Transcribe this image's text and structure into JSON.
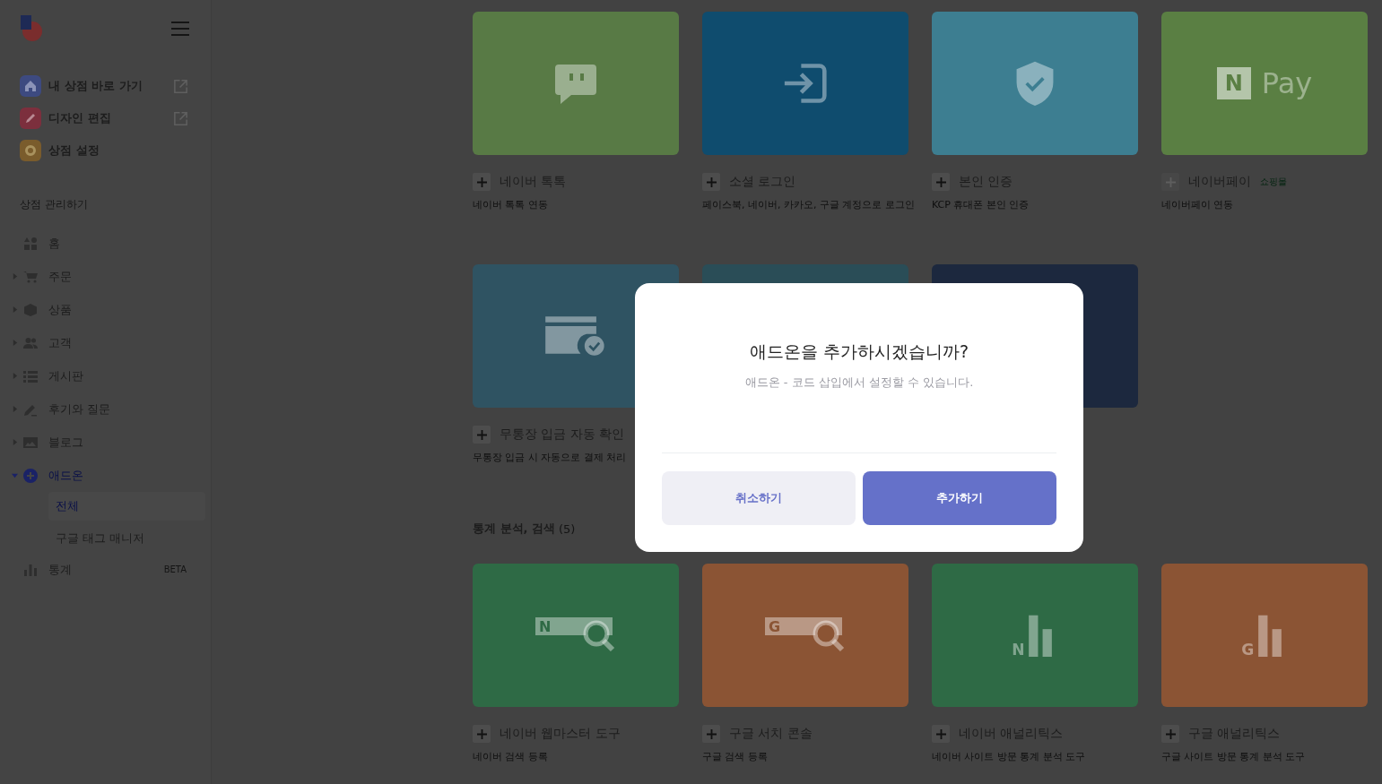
{
  "sidebar": {
    "quick_links": [
      {
        "label": "내 상점 바로 가기",
        "color": "#3d4a80",
        "external": true
      },
      {
        "label": "디자인 편집",
        "color": "#7c2f3d",
        "external": true
      },
      {
        "label": "상점 설정",
        "color": "#7a5c2c",
        "external": false
      }
    ],
    "section_label": "상점 관리하기",
    "nav": [
      {
        "label": "홈",
        "selected": false
      },
      {
        "label": "주문",
        "selected": false,
        "expanded": false
      },
      {
        "label": "상품",
        "selected": false,
        "expanded": false
      },
      {
        "label": "고객",
        "selected": false,
        "expanded": false
      },
      {
        "label": "게시판",
        "selected": false,
        "expanded": false
      },
      {
        "label": "후기와 질문",
        "selected": false,
        "expanded": false
      },
      {
        "label": "블로그",
        "selected": false,
        "expanded": false
      },
      {
        "label": "애드온",
        "selected": true,
        "expanded": true,
        "children": [
          {
            "label": "전체",
            "selected": true
          },
          {
            "label": "구글 태그 매니저",
            "selected": false
          }
        ]
      },
      {
        "label": "통계",
        "selected": false,
        "badge": "BETA"
      }
    ]
  },
  "sections": [
    {
      "cards": [
        {
          "title": "네이버 톡톡",
          "description": "네이버 톡톡 연동",
          "color": "#587a45",
          "disabled": false
        },
        {
          "title": "소셜 로그인",
          "description": "페이스북, 네이버, 카카오, 구글 계정으로 로그인",
          "color": "#0f4c6e",
          "disabled": false
        },
        {
          "title": "본인 인증",
          "description": "KCP 휴대폰 본인 인증",
          "color": "#3d7e91",
          "disabled": false
        },
        {
          "title": "네이버페이",
          "tag": "쇼핑몰",
          "description": "네이버페이 연동",
          "color": "#5a7f43",
          "disabled": true,
          "logo": {
            "mark": "N",
            "text": "Pay"
          }
        },
        {
          "title": "무통장 입금 자동 확인",
          "description": "무통장 입금 시 자동으로 결제 처리",
          "color": "#2f5362",
          "disabled": false
        },
        {
          "color": "#2a4d57"
        },
        {
          "color": "#1c283e"
        }
      ]
    },
    {
      "title": "통계 분석, 검색",
      "count": "(5)",
      "cards": [
        {
          "title": "네이버 웹마스터 도구",
          "description": "네이버 검색 등록",
          "color": "#2e6a45",
          "disabled": false,
          "mark": "N"
        },
        {
          "title": "구글 서치 콘솔",
          "description": "구글 검색 등록",
          "color": "#8b5434",
          "disabled": false,
          "mark": "G"
        },
        {
          "title": "네이버 애널리틱스",
          "description": "네이버 사이트 방문 통계 분석 도구",
          "color": "#2e6a45",
          "disabled": false,
          "mark": "N"
        },
        {
          "title": "구글 애널리틱스",
          "description": "구글 사이트 방문 통계 분석 도구",
          "color": "#8b5434",
          "disabled": false,
          "mark": "G"
        }
      ]
    }
  ],
  "dialog": {
    "title": "애드온을 추가하시겠습니까?",
    "message": "애드온 - 코드 삽입에서 설정할 수 있습니다.",
    "buttons": [
      {
        "label": "취소하기",
        "kind": "cancel"
      },
      {
        "label": "추가하기",
        "kind": "confirm"
      }
    ]
  }
}
